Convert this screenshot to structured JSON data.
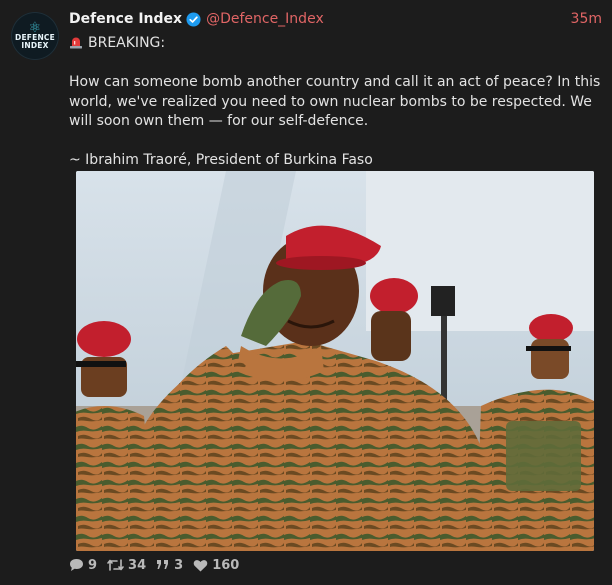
{
  "author": {
    "logo_text_line1": "DEFENCE",
    "logo_text_line2": "INDEX",
    "name": "Defence Index",
    "handle": "@Defence_Index",
    "time": "35m"
  },
  "post": {
    "headline": "BREAKING:",
    "paragraph": "How can someone bomb another country and call it an act of peace? In this world, we've realized you need to own nuclear bombs to be respected. We will soon own them — for our self-defence.",
    "attribution": "~ Ibrahim Traoré, President of Burkina Faso"
  },
  "stats": {
    "replies": "9",
    "reposts": "34",
    "quotes": "3",
    "likes": "160"
  },
  "icons": {
    "verified": "verified-badge-icon",
    "siren": "siren-emoji-icon",
    "reply": "speech-bubble-icon",
    "repost": "repost-arrows-icon",
    "quote": "quote-marks-icon",
    "like": "heart-icon"
  },
  "colors": {
    "background": "#1c1c1c",
    "accent": "#e06565",
    "verified": "#1d9bf0"
  }
}
